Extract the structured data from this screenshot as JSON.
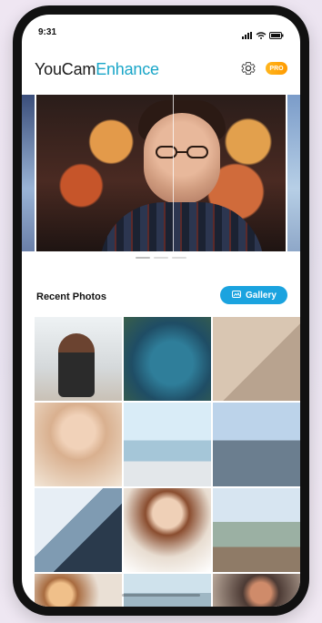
{
  "status_bar": {
    "time": "9:31"
  },
  "app_bar": {
    "brand_part1": "YouCam",
    "brand_part2": "Enhance",
    "pro_badge": "PRO",
    "icons": [
      "gear-icon"
    ]
  },
  "hero": {
    "pager": {
      "pages": 3,
      "active_index": 0
    }
  },
  "recent": {
    "title": "Recent Photos",
    "gallery_label": "Gallery",
    "photos": [
      "photo-1",
      "photo-2",
      "photo-3",
      "photo-4",
      "photo-5",
      "photo-6",
      "photo-7",
      "photo-8",
      "photo-9",
      "photo-10",
      "photo-11",
      "photo-12"
    ]
  },
  "colors": {
    "accent_blue": "#1ba3df",
    "brand_teal": "#1aa6c8",
    "pro_orange": "#ffb61e"
  }
}
